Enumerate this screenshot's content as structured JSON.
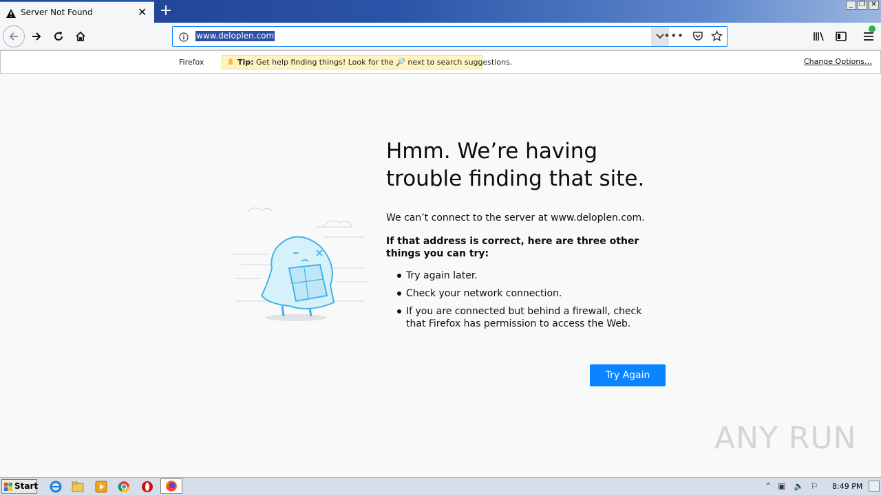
{
  "tab": {
    "title": "Server Not Found"
  },
  "navbar": {
    "url": "www.deloplen.com"
  },
  "tipbar": {
    "engine": "Firefox",
    "tip_label": "Tip:",
    "tip_text": "Get help finding things! Look for the",
    "tip_text_after": "next to search suggestions.",
    "change_options": "Change Options…"
  },
  "error": {
    "title": "Hmm. We’re having trouble finding that site.",
    "description": "We can’t connect to the server at www.deloplen.com.",
    "subhead": "If that address is correct, here are three other things you can try:",
    "tips": [
      "Try again later.",
      "Check your network connection.",
      "If you are connected but behind a firewall, check that Firefox has permission to access the Web."
    ],
    "button": "Try Again"
  },
  "watermark": "ANY RUN",
  "taskbar": {
    "start": "Start",
    "clock": "8:49 PM"
  },
  "colors": {
    "accent": "#0a84ff",
    "titlebar": "#2b54a8"
  },
  "icons": [
    "warning-icon",
    "close-icon",
    "plus-icon",
    "back-arrow-icon",
    "forward-arrow-icon",
    "reload-icon",
    "home-icon",
    "info-icon",
    "chevron-down-icon",
    "more-icon",
    "pocket-icon",
    "star-icon",
    "library-icon",
    "sidebar-icon",
    "menu-icon",
    "magnifier-icon"
  ]
}
